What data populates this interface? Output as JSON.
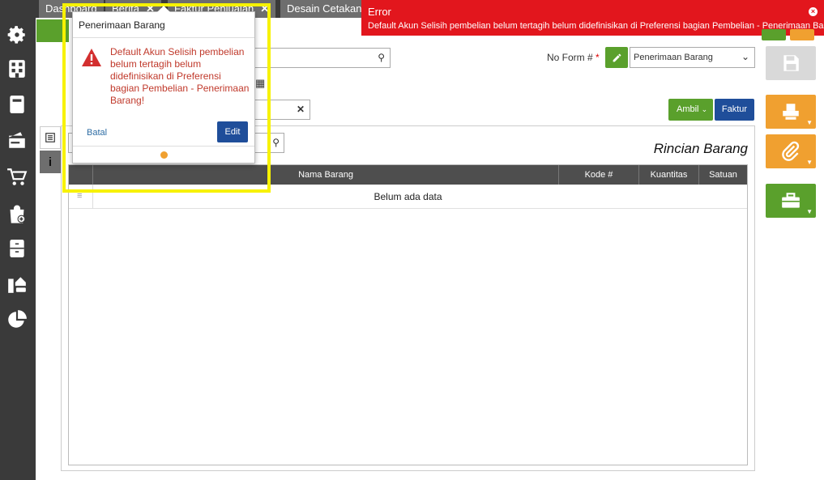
{
  "tabs": [
    {
      "label": "Dashboard",
      "closable": false
    },
    {
      "label": "Berita",
      "closable": true
    },
    {
      "label": "Faktur Penjualan",
      "closable": true
    },
    {
      "label": "Desain Cetakan",
      "closable": false
    }
  ],
  "sidebar": {
    "icons": [
      "settings-icon",
      "building-icon",
      "ledger-icon",
      "wallet-icon",
      "cart-icon",
      "bag-add-icon",
      "cabinet-icon",
      "assets-icon",
      "pie-chart-icon"
    ]
  },
  "toast": {
    "title": "Error",
    "message": "Default Akun Selisih pembelian belum tertagih belum didefinisikan di Preferensi bagian Pembelian - Penerimaan Barang!",
    "close": "×"
  },
  "form": {
    "no_form_label": "No Form #",
    "required_mark": "*",
    "form_type_value": "Penerimaan Barang",
    "ambil_label": "Ambil",
    "faktur_label": "Faktur"
  },
  "detail": {
    "title": "Rincian Barang",
    "columns": [
      "Nama Barang",
      "Kode #",
      "Kuantitas",
      "Satuan"
    ],
    "empty_text": "Belum ada data"
  },
  "popover": {
    "title": "Penerimaan Barang",
    "message": "Default Akun Selisih pembelian belum tertagih belum didefinisikan di Preferensi bagian Pembelian - Penerimaan Barang!",
    "cancel_label": "Batal",
    "edit_label": "Edit"
  },
  "colors": {
    "accent_green": "#5aa02c",
    "primary_blue": "#1f4e9a",
    "error_red": "#e2161d",
    "warning_orange": "#f0a030",
    "highlight_yellow": "#f7f200",
    "sidebar_dark": "#3a3a3a"
  }
}
